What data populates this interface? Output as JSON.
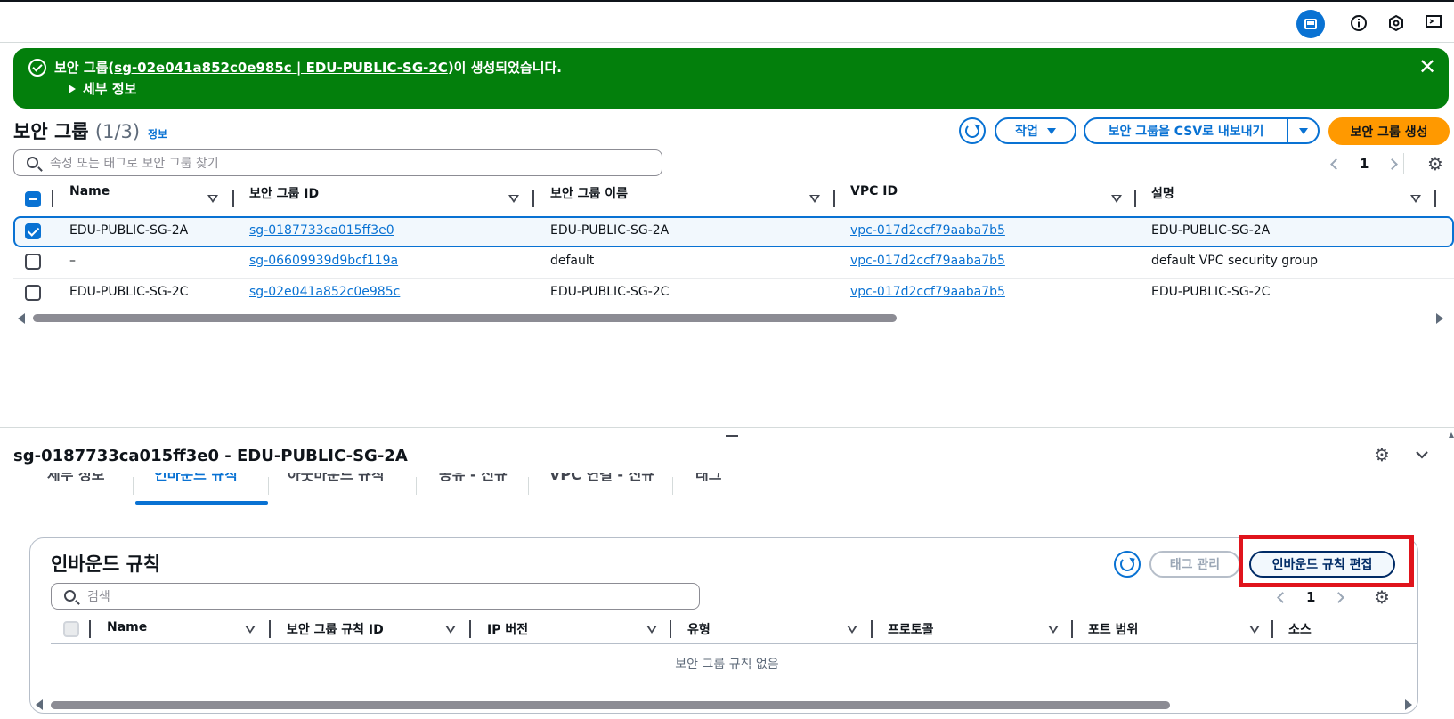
{
  "topbar": {
    "icons": [
      "panel-icon",
      "info-icon",
      "settings-hex-icon",
      "cloudshell-icon"
    ]
  },
  "flash": {
    "prefix": "보안 그룹(",
    "link": "sg-02e041a852c0e985c | EDU-PUBLIC-SG-2C",
    "suffix": ")이 생성되었습니다.",
    "detail": "세부 정보",
    "color": "#037f0c"
  },
  "header": {
    "title": "보안 그룹",
    "count": "(1/3)",
    "info": "정보",
    "actions_label": "작업",
    "export_label": "보안 그룹을 CSV로 내보내기",
    "create_label": "보안 그룹 생성"
  },
  "search": {
    "placeholder": "속성 또는 태그로 보안 그룹 찾기"
  },
  "pagination": {
    "page": "1"
  },
  "table": {
    "columns": [
      "Name",
      "보안 그룹 ID",
      "보안 그룹 이름",
      "VPC ID",
      "설명"
    ],
    "rows": [
      {
        "selected": true,
        "name": "EDU-PUBLIC-SG-2A",
        "id": "sg-0187733ca015ff3e0",
        "group_name": "EDU-PUBLIC-SG-2A",
        "vpc": "vpc-017d2ccf79aaba7b5",
        "desc": "EDU-PUBLIC-SG-2A"
      },
      {
        "selected": false,
        "name": "–",
        "id": "sg-06609939d9bcf119a",
        "group_name": "default",
        "vpc": "vpc-017d2ccf79aaba7b5",
        "desc": "default VPC security group"
      },
      {
        "selected": false,
        "name": "EDU-PUBLIC-SG-2C",
        "id": "sg-02e041a852c0e985c",
        "group_name": "EDU-PUBLIC-SG-2C",
        "vpc": "vpc-017d2ccf79aaba7b5",
        "desc": "EDU-PUBLIC-SG-2C"
      }
    ]
  },
  "detail": {
    "title": "sg-0187733ca015ff3e0 - EDU-PUBLIC-SG-2A",
    "tabs": [
      "세부 정보",
      "인바운드 규칙",
      "아웃바운드 규칙",
      "공유 - 신규",
      "VPC 연결 - 신규",
      "태그"
    ],
    "active_tab": "인바운드 규칙"
  },
  "inbound": {
    "title": "인바운드 규칙",
    "manage_tags_label": "태그 관리",
    "edit_label": "인바운드 규칙 편집",
    "search_placeholder": "검색",
    "page": "1",
    "columns": [
      "Name",
      "보안 그룹 규칙 ID",
      "IP 버전",
      "유형",
      "프로토콜",
      "포트 범위",
      "소스"
    ],
    "empty": "보안 그룹 규칙 없음"
  },
  "colors": {
    "accent": "#0972d3",
    "primary_button": "#ff9900",
    "highlight": "#e0141c"
  }
}
